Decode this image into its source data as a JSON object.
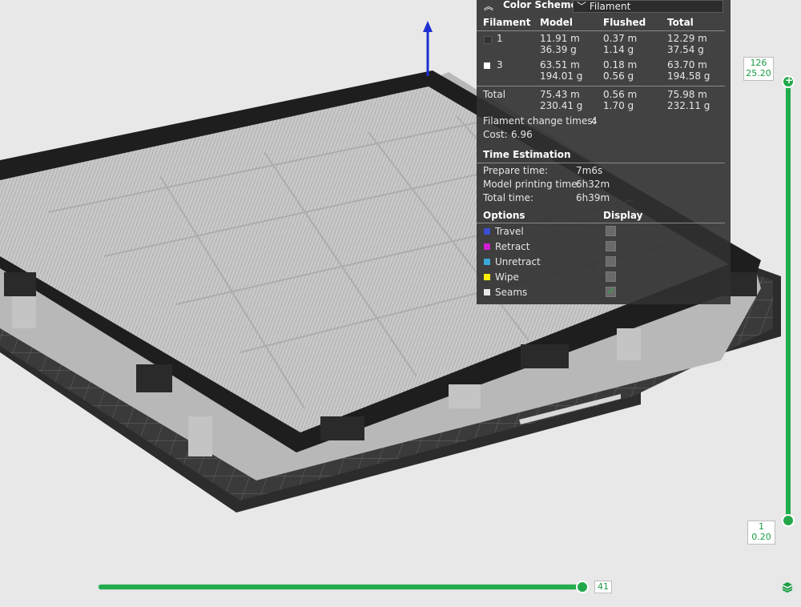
{
  "panel": {
    "color_scheme_label": "Color Scheme",
    "color_scheme_value": "Filament",
    "columns": [
      "Filament",
      "Model",
      "Flushed",
      "Total"
    ],
    "filaments": [
      {
        "id": "1",
        "color": "#333333",
        "model_m": "11.91 m",
        "model_g": "36.39 g",
        "flushed_m": "0.37 m",
        "flushed_g": "1.14 g",
        "total_m": "12.29 m",
        "total_g": "37.54 g"
      },
      {
        "id": "3",
        "color": "#ffffff",
        "model_m": "63.51 m",
        "model_g": "194.01 g",
        "flushed_m": "0.18 m",
        "flushed_g": "0.56 g",
        "total_m": "63.70 m",
        "total_g": "194.58 g"
      }
    ],
    "total": {
      "label": "Total",
      "model_m": "75.43 m",
      "model_g": "230.41 g",
      "flushed_m": "0.56 m",
      "flushed_g": "1.70 g",
      "total_m": "75.98 m",
      "total_g": "232.11 g"
    },
    "filament_change": {
      "label": "Filament change times:",
      "value": "4"
    },
    "cost": {
      "label": "Cost:",
      "value": "6.96"
    },
    "time_estimation": {
      "header": "Time Estimation",
      "rows": [
        {
          "label": "Prepare time:",
          "value": "7m6s"
        },
        {
          "label": "Model printing time:",
          "value": "6h32m"
        },
        {
          "label": "Total time:",
          "value": "6h39m"
        }
      ]
    },
    "options": {
      "header": "Options",
      "display_header": "Display",
      "items": [
        {
          "label": "Travel",
          "color": "#3a4fd0",
          "checked": false
        },
        {
          "label": "Retract",
          "color": "#d020d0",
          "checked": false
        },
        {
          "label": "Unretract",
          "color": "#3aa8d8",
          "checked": false
        },
        {
          "label": "Wipe",
          "color": "#ffee00",
          "checked": false
        },
        {
          "label": "Seams",
          "color": "#e8e8e8",
          "checked": true
        }
      ]
    }
  },
  "vertical_slider": {
    "top_layer": "126",
    "top_height": "25.20",
    "bottom_layer": "1",
    "bottom_height": "0.20"
  },
  "horizontal_slider": {
    "value": "41",
    "fill_fraction": 1.0
  },
  "colors": {
    "accent": "#1fae4b",
    "panel_bg": "#303030",
    "canvas_bg": "#e8e8e8"
  }
}
